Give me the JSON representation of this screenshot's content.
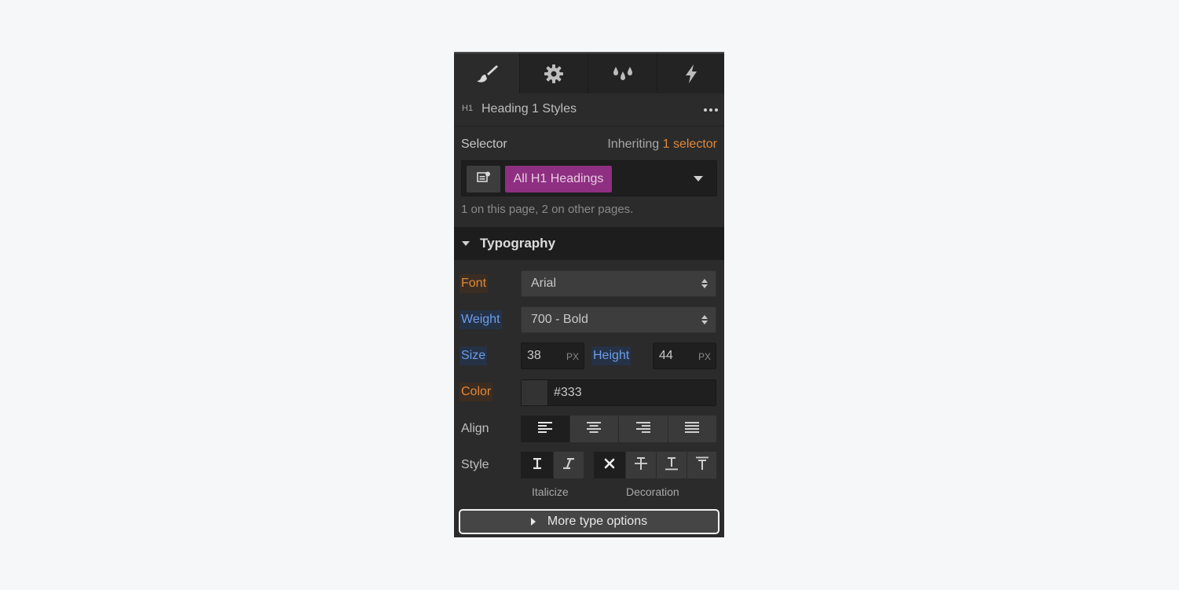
{
  "tabs": [
    {
      "icon": "paintbrush-icon",
      "active": true
    },
    {
      "icon": "gear-icon",
      "active": false
    },
    {
      "icon": "drops-icon",
      "active": false
    },
    {
      "icon": "lightning-icon",
      "active": false
    }
  ],
  "header": {
    "tag": "H1",
    "title": "Heading 1 Styles"
  },
  "selector": {
    "label": "Selector",
    "inheriting_prefix": "Inheriting",
    "inheriting_count": "1 selector",
    "chip": "All H1 Headings",
    "page_count": "1 on this page, 2 on other pages."
  },
  "typography": {
    "title": "Typography",
    "font_label": "Font",
    "font_value": "Arial",
    "weight_label": "Weight",
    "weight_value": "700 - Bold",
    "size_label": "Size",
    "size_value": "38",
    "size_unit": "PX",
    "height_label": "Height",
    "height_value": "44",
    "height_unit": "PX",
    "color_label": "Color",
    "color_value": "#333",
    "align_label": "Align",
    "style_label": "Style",
    "italicize_caption": "Italicize",
    "decoration_caption": "Decoration",
    "more_label": "More type options"
  }
}
